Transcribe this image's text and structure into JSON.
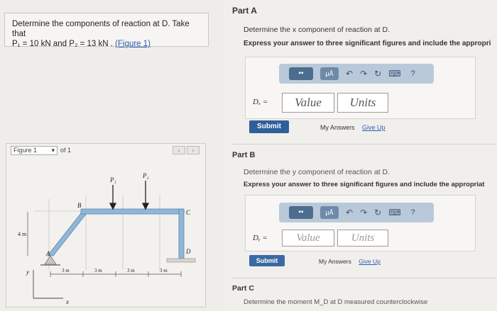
{
  "problem": {
    "line1": "Determine the components of reaction at D. Take that",
    "line2_pre": "P₁ = 10 kN and P₂ = 13 kN .",
    "figure_link": "(Figure 1)"
  },
  "figure": {
    "selector": "Figure 1",
    "of_label": "of 1",
    "labels": {
      "P1": "P₁",
      "P2": "P₂",
      "A": "A",
      "B": "B",
      "C": "C",
      "D": "D",
      "height": "4 m",
      "x": "x",
      "y": "y",
      "dim1": "3 m",
      "dim2": "3 m",
      "dim3": "3 m",
      "dim4": "3 m"
    }
  },
  "partA": {
    "title": "Part A",
    "prompt": "Determine the x component of reaction at D.",
    "instruction": "Express your answer to three significant figures and include the appropri",
    "var_label": "Dₓ =",
    "value_placeholder": "Value",
    "units_placeholder": "Units",
    "submit": "Submit",
    "my_answers": "My Answers",
    "give_up": "Give Up"
  },
  "partB": {
    "title": "Part B",
    "prompt": "Determine the y component of reaction at D.",
    "instruction": "Express your answer to three significant figures and include the appropriat",
    "var_label": "Dᵧ =",
    "value_placeholder": "Value",
    "units_placeholder": "Units",
    "submit": "Submit",
    "my_answers": "My Answers",
    "give_up": "Give Up"
  },
  "partC": {
    "title": "Part C",
    "prompt": "Determine the moment M_D at D measured counterclockwise"
  },
  "toolbar": {
    "template_icon": "template-icon",
    "mu_label": "μÅ",
    "undo_icon": "undo-icon",
    "redo_icon": "redo-icon",
    "reset_icon": "reset-icon",
    "keyboard_icon": "keyboard-icon",
    "help_label": "?"
  }
}
